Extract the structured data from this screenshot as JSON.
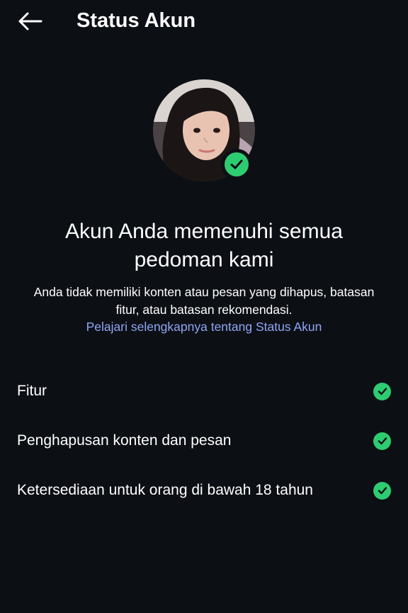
{
  "header": {
    "title": "Status Akun",
    "back_icon": "arrow-left-icon"
  },
  "profile": {
    "verified_icon": "check-circle-icon",
    "check_color": "#2ecc71"
  },
  "main": {
    "headline": "Akun Anda memenuhi semua pedoman kami",
    "description": "Anda tidak memiliki konten atau pesan yang dihapus, batasan fitur, atau batasan rekomendasi.",
    "learn_more_link": "Pelajari selengkapnya tentang Status Akun",
    "link_color": "#8fa6f4"
  },
  "status_items": [
    {
      "label": "Fitur",
      "icon": "check-circle-icon"
    },
    {
      "label": "Penghapusan konten dan pesan",
      "icon": "check-circle-icon"
    },
    {
      "label": "Ketersediaan untuk orang di bawah 18 tahun",
      "icon": "check-circle-icon"
    }
  ]
}
